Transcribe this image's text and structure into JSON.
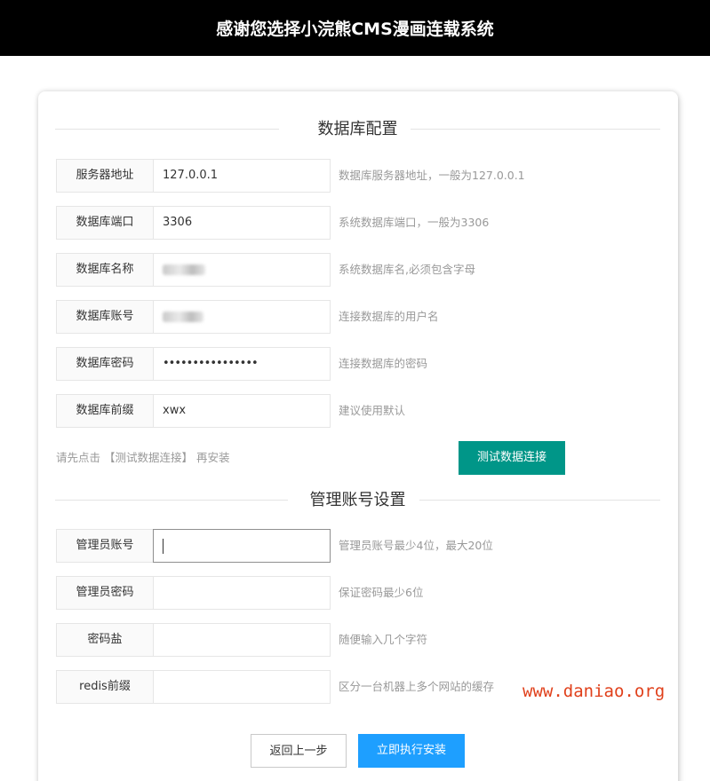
{
  "header": {
    "title": "感谢您选择小浣熊CMS漫画连载系统"
  },
  "database_section": {
    "title": "数据库配置",
    "fields": [
      {
        "label": "服务器地址",
        "value": "127.0.0.1",
        "hint": "数据库服务器地址，一般为127.0.0.1"
      },
      {
        "label": "数据库端口",
        "value": "3306",
        "hint": "系统数据库端口，一般为3306"
      },
      {
        "label": "数据库名称",
        "value": "",
        "hint": "系统数据库名,必须包含字母"
      },
      {
        "label": "数据库账号",
        "value": "",
        "hint": "连接数据库的用户名"
      },
      {
        "label": "数据库密码",
        "value": "••••••••••••••••",
        "hint": "连接数据库的密码"
      },
      {
        "label": "数据库前缀",
        "value": "xwx",
        "hint": "建议使用默认"
      }
    ],
    "notice": "请先点击 【测试数据连接】 再安装",
    "test_button": "测试数据连接"
  },
  "admin_section": {
    "title": "管理账号设置",
    "fields": [
      {
        "label": "管理员账号",
        "value": "",
        "hint": "管理员账号最少4位，最大20位"
      },
      {
        "label": "管理员密码",
        "value": "",
        "hint": "保证密码最少6位"
      },
      {
        "label": "密码盐",
        "value": "",
        "hint": "随便输入几个字符"
      },
      {
        "label": "redis前缀",
        "value": "",
        "hint": "区分一台机器上多个网站的缓存"
      }
    ]
  },
  "actions": {
    "back": "返回上一步",
    "install": "立即执行安装"
  },
  "watermark": "www.daniao.org",
  "colors": {
    "header_bg": "#000000",
    "test_button": "#009688",
    "install_button": "#1e9fff",
    "watermark": "#e0401b"
  }
}
